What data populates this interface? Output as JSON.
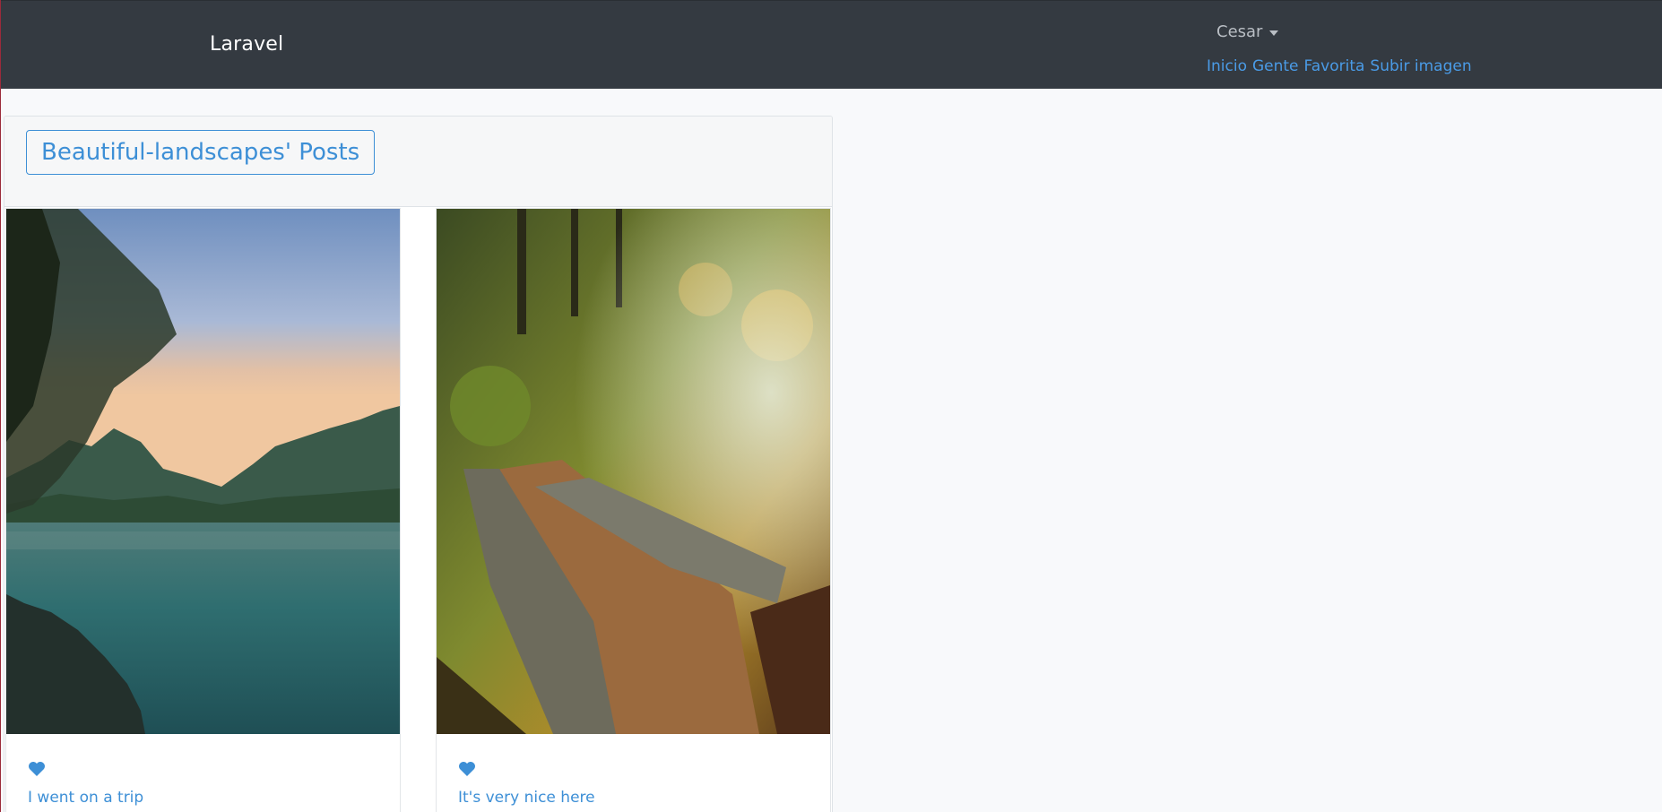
{
  "navbar": {
    "brand": "Laravel",
    "user_name": "Cesar",
    "links": [
      "Inicio",
      "Gente",
      "Favorita",
      "Subir imagen"
    ]
  },
  "profile": {
    "title": "Beautiful-landscapes' Posts"
  },
  "posts": [
    {
      "caption": "I went on a trip",
      "image": "lake-sunset-landscape"
    },
    {
      "caption": "It's very nice here",
      "image": "autumn-forest-bridge"
    }
  ],
  "colors": {
    "navbar_bg": "#343a41",
    "accent": "#3d8fd6",
    "page_bg": "#f8f9fb"
  }
}
